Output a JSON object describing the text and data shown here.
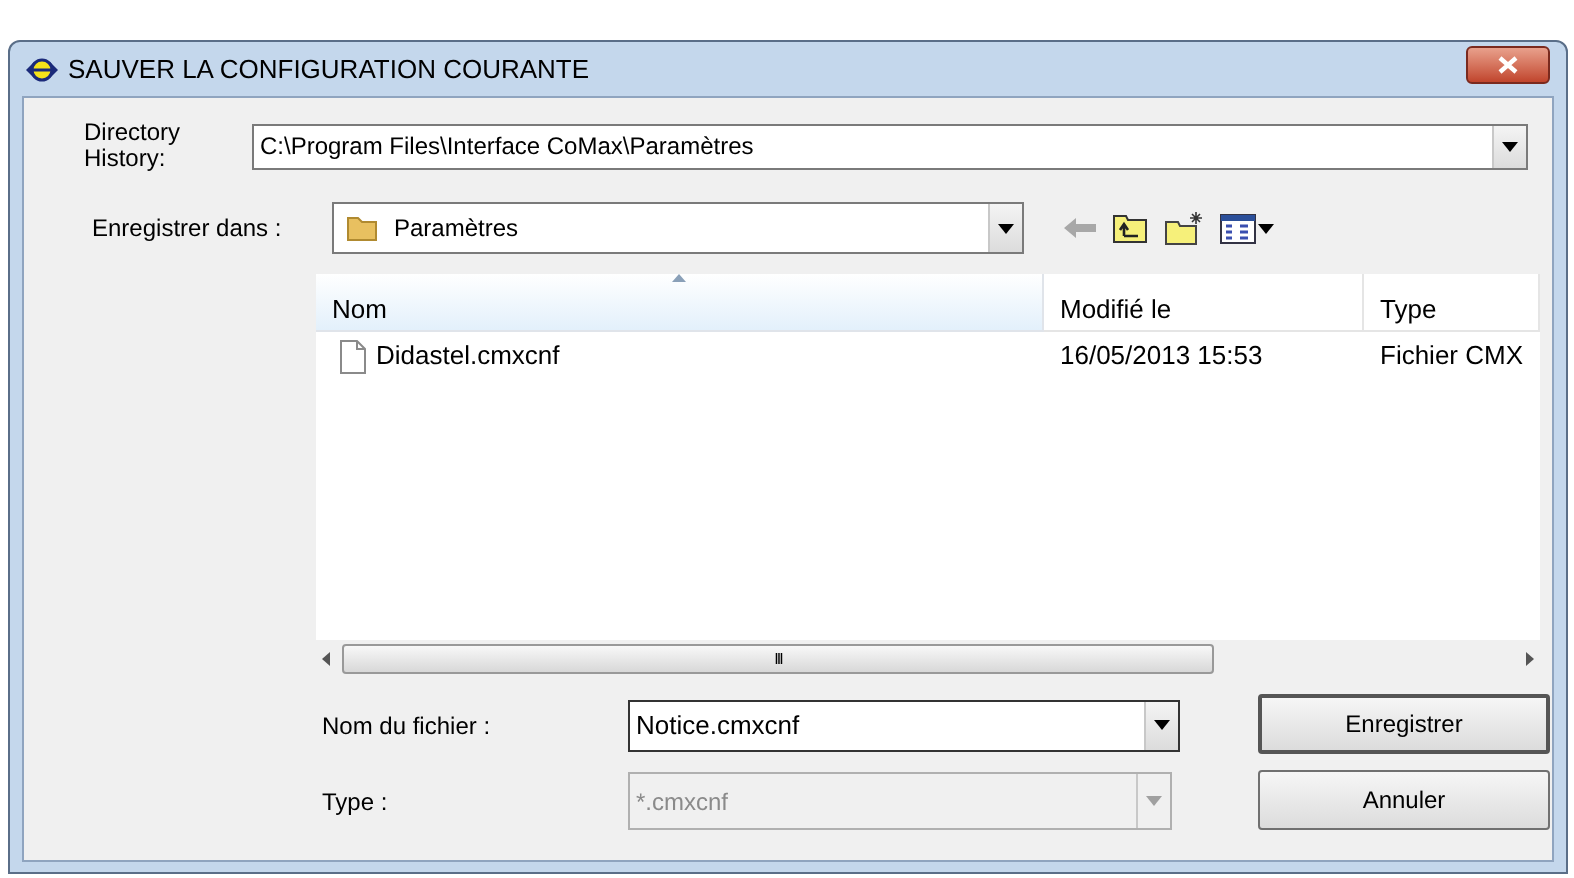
{
  "window": {
    "title": "SAUVER LA CONFIGURATION COURANTE"
  },
  "directory_history": {
    "label": "Directory History:",
    "value": "C:\\Program Files\\Interface CoMax\\Paramètres"
  },
  "save_in": {
    "label": "Enregistrer dans :",
    "value": "Paramètres"
  },
  "file_list": {
    "columns": [
      {
        "label": "Nom",
        "sorted": true
      },
      {
        "label": "Modifié le",
        "sorted": false
      },
      {
        "label": "Type",
        "sorted": false
      }
    ],
    "rows": [
      {
        "name": "Didastel.cmxcnf",
        "modified": "16/05/2013 15:53",
        "type": "Fichier CMX"
      }
    ],
    "scroll_grip": "III"
  },
  "file_name": {
    "label": "Nom du fichier :",
    "value": "Notice.cmxcnf"
  },
  "file_type": {
    "label": "Type :",
    "value": "*.cmxcnf",
    "disabled": true
  },
  "buttons": [
    {
      "label": "Enregistrer",
      "default": true
    },
    {
      "label": "Annuler",
      "default": false
    }
  ]
}
